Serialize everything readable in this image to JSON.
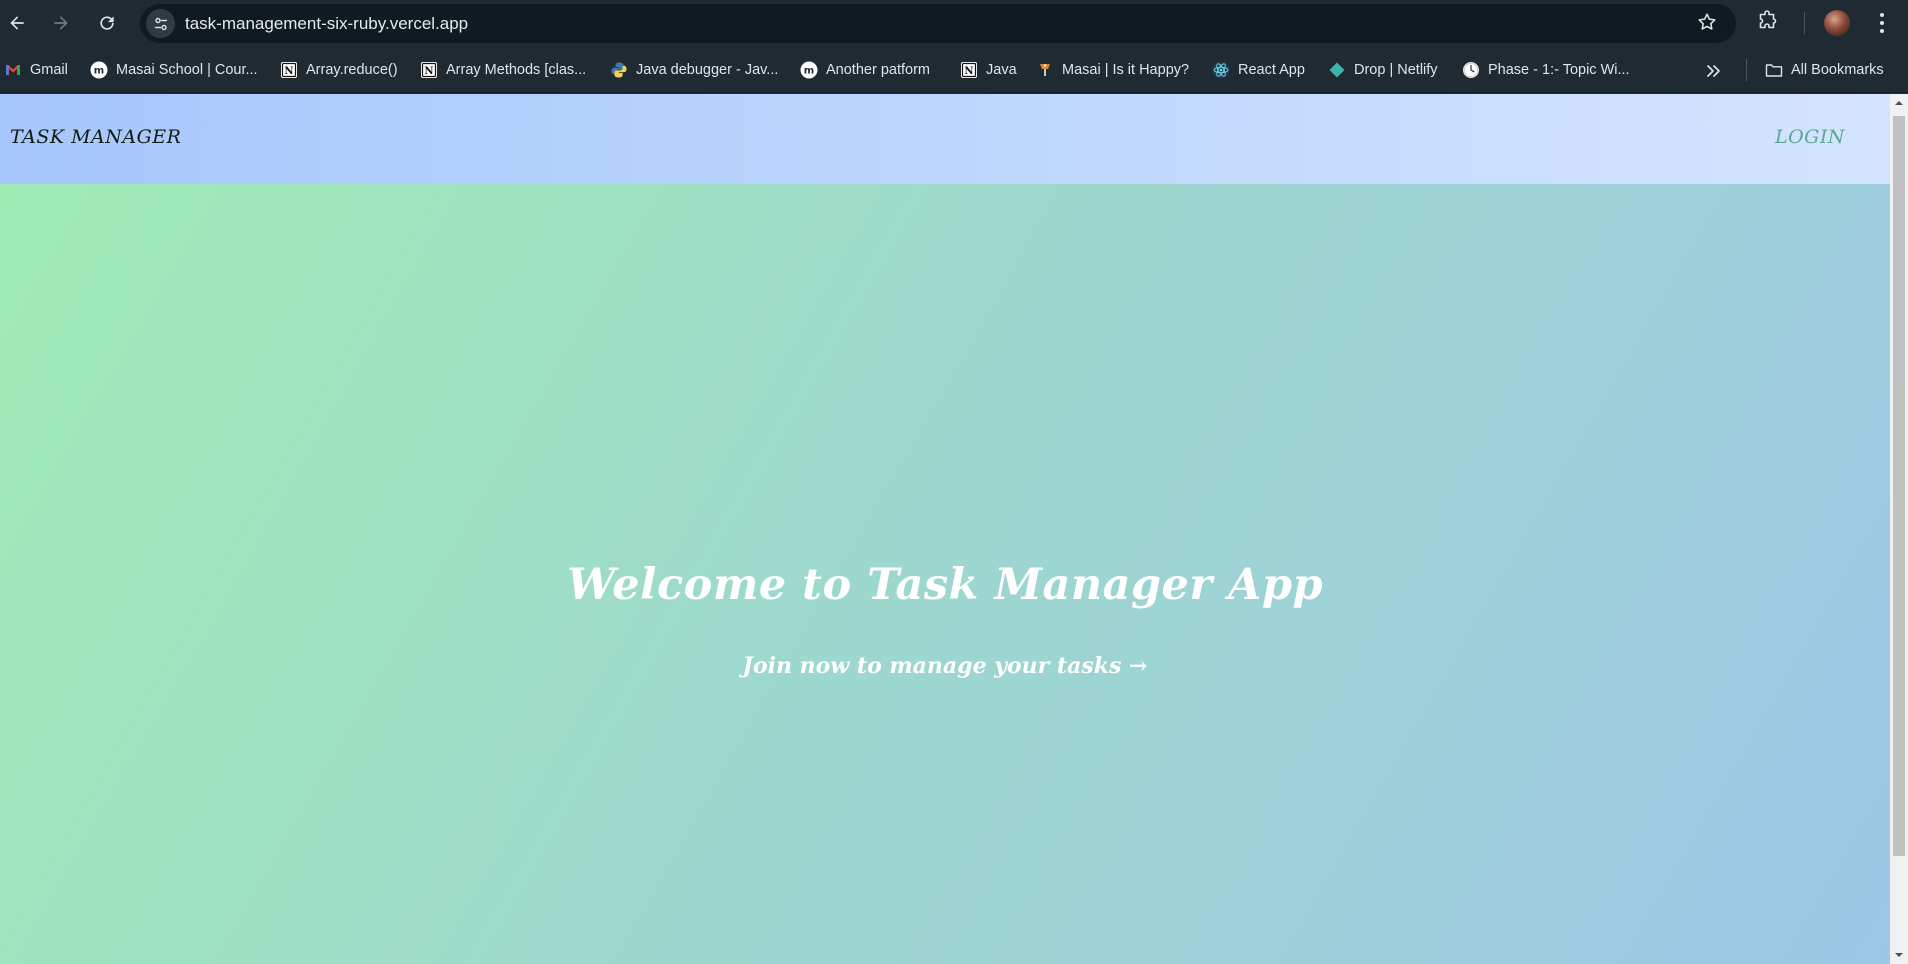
{
  "browser": {
    "url": "task-management-six-ruby.vercel.app",
    "icons": {
      "back": "arrow-left-icon",
      "forward": "arrow-right-icon",
      "reload": "reload-icon",
      "site_info": "tune-icon",
      "bookmark_star": "star-icon",
      "extensions": "puzzle-icon",
      "menu": "kebab-menu-icon"
    }
  },
  "bookmarks": {
    "items": [
      {
        "label": "Gmail",
        "icon": "gmail-icon"
      },
      {
        "label": "Masai School | Cour...",
        "icon": "masai-icon"
      },
      {
        "label": "Array.reduce()",
        "icon": "notion-icon"
      },
      {
        "label": "Array Methods [clas...",
        "icon": "notion-icon"
      },
      {
        "label": "Java debugger - Jav...",
        "icon": "python-icon"
      },
      {
        "label": "Another patform",
        "icon": "masai-icon"
      },
      {
        "label": "Java",
        "icon": "notion-icon"
      },
      {
        "label": "Masai | Is it Happy?",
        "icon": "masai-happy-icon"
      },
      {
        "label": "React App",
        "icon": "react-icon"
      },
      {
        "label": "Drop | Netlify",
        "icon": "netlify-icon"
      },
      {
        "label": "Phase - 1:- Topic Wi...",
        "icon": "clock-icon"
      }
    ],
    "overflow_icon": "double-chevron-icon",
    "all_bookmarks": {
      "label": "All Bookmarks",
      "icon": "folder-icon"
    }
  },
  "page": {
    "brand": "TASK MANAGER",
    "login": "LOGIN",
    "hero_title": "Welcome to Task Manager App",
    "hero_cta": "Join now to manage your tasks →"
  },
  "colors": {
    "chrome_bg": "#1f2a33",
    "omnibox_bg": "#101a21",
    "header_gradient_start": "#a7c6fb",
    "header_gradient_end": "#d4e4fe",
    "hero_gradient_start": "#a0ecb3",
    "hero_gradient_end": "#9dc7e6",
    "login_link": "#5aa892",
    "hero_text": "#ffffff"
  }
}
